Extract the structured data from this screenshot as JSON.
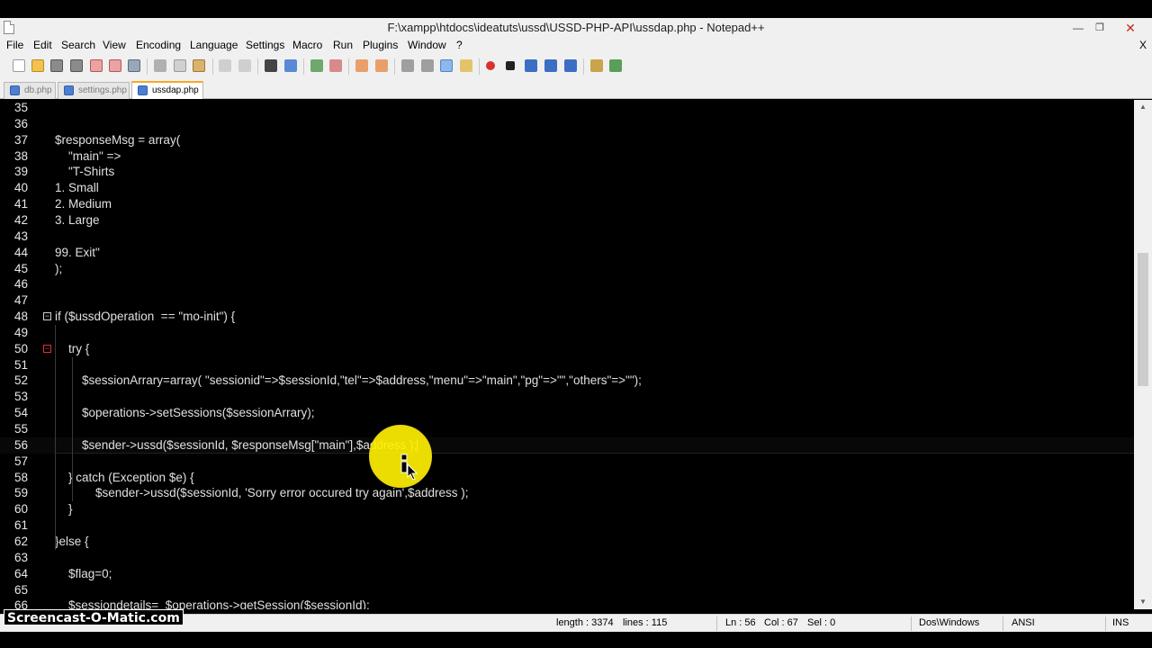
{
  "window": {
    "title": "F:\\xampp\\htdocs\\ideatuts\\ussd\\USSD-PHP-API\\ussdap.php - Notepad++",
    "min_label": "—",
    "max_label": "❐",
    "close_label": "✕"
  },
  "menu": {
    "items": [
      "File",
      "Edit",
      "Search",
      "View",
      "Encoding",
      "Language",
      "Settings",
      "Macro",
      "Run",
      "Plugins",
      "Window",
      "?"
    ],
    "close_doc": "X"
  },
  "tabs": [
    {
      "label": "db.php",
      "active": false,
      "icon": "php-file-icon"
    },
    {
      "label": "settings.php",
      "active": false,
      "icon": "php-file-icon"
    },
    {
      "label": "ussdap.php",
      "active": true,
      "icon": "php-file-icon"
    }
  ],
  "editor": {
    "lines": [
      {
        "num": "35",
        "code": ""
      },
      {
        "num": "36",
        "code": ""
      },
      {
        "num": "37",
        "code": "$responseMsg = array("
      },
      {
        "num": "38",
        "code": "    \"main\" =>"
      },
      {
        "num": "39",
        "code": "    \"T-Shirts"
      },
      {
        "num": "40",
        "code": "1. Small"
      },
      {
        "num": "41",
        "code": "2. Medium"
      },
      {
        "num": "42",
        "code": "3. Large"
      },
      {
        "num": "43",
        "code": ""
      },
      {
        "num": "44",
        "code": "99. Exit\""
      },
      {
        "num": "45",
        "code": ");"
      },
      {
        "num": "46",
        "code": ""
      },
      {
        "num": "47",
        "code": ""
      },
      {
        "num": "48",
        "code": "if ($ussdOperation  == \"mo-init\") {"
      },
      {
        "num": "49",
        "code": ""
      },
      {
        "num": "50",
        "code": "    try {"
      },
      {
        "num": "51",
        "code": ""
      },
      {
        "num": "52",
        "code": "        $sessionArrary=array( \"sessionid\"=>$sessionId,\"tel\"=>$address,\"menu\"=>\"main\",\"pg\"=>\"\",\"others\"=>\"\");"
      },
      {
        "num": "53",
        "code": ""
      },
      {
        "num": "54",
        "code": "        $operations->setSessions($sessionArrary);"
      },
      {
        "num": "55",
        "code": ""
      },
      {
        "num": "56",
        "code": "        $sender->ussd($sessionId, $responseMsg[\"main\"],$address );"
      },
      {
        "num": "57",
        "code": ""
      },
      {
        "num": "58",
        "code": "    } catch (Exception $e) {"
      },
      {
        "num": "59",
        "code": "            $sender->ussd($sessionId, 'Sorry error occured try again',$address );"
      },
      {
        "num": "60",
        "code": "    }"
      },
      {
        "num": "61",
        "code": ""
      },
      {
        "num": "62",
        "code": "}else {"
      },
      {
        "num": "63",
        "code": ""
      },
      {
        "num": "64",
        "code": "    $flag=0;"
      },
      {
        "num": "65",
        "code": ""
      },
      {
        "num": "66",
        "code": "    $sessiondetails=  $operations->getSession($sessionId);"
      }
    ]
  },
  "status": {
    "length": "length : 3374",
    "lines": "lines : 115",
    "ln": "Ln : 56",
    "col": "Col : 67",
    "sel": "Sel : 0",
    "eol": "Dos\\Windows",
    "encoding": "ANSI",
    "mode": "INS"
  },
  "watermark": "Screencast-O-Matic.com",
  "colors": {
    "editor_bg": "#000000",
    "chrome_bg": "#f0f0f0",
    "active_tab_accent": "#f9a825",
    "cursor_highlight": "#fff000"
  }
}
